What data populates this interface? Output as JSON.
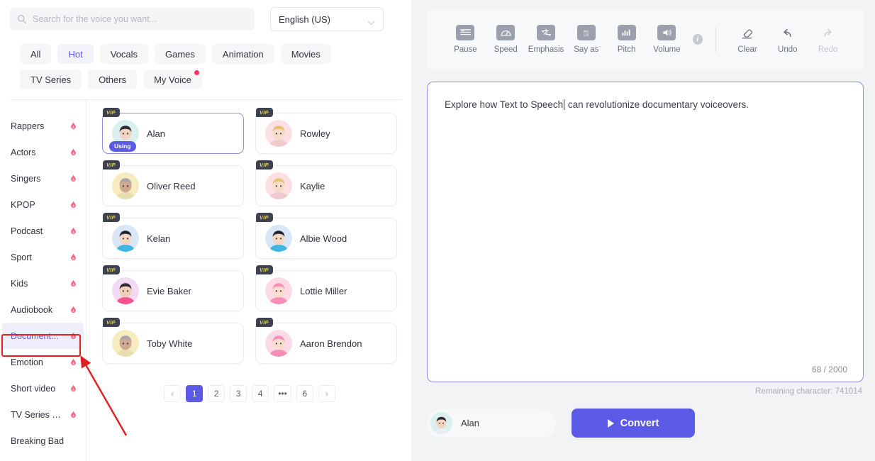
{
  "search": {
    "placeholder": "Search for the voice you want...",
    "value": "",
    "icon": "search-icon"
  },
  "language": {
    "selected": "English (US)",
    "icon": "chevron-down-icon"
  },
  "category_tabs": [
    {
      "label": "All",
      "active": false,
      "badge": false
    },
    {
      "label": "Hot",
      "active": true,
      "badge": false
    },
    {
      "label": "Vocals",
      "active": false,
      "badge": false
    },
    {
      "label": "Games",
      "active": false,
      "badge": false
    },
    {
      "label": "Animation",
      "active": false,
      "badge": false
    },
    {
      "label": "Movies",
      "active": false,
      "badge": false
    },
    {
      "label": "TV Series",
      "active": false,
      "badge": false
    },
    {
      "label": "Others",
      "active": false,
      "badge": false
    },
    {
      "label": "My Voice",
      "active": false,
      "badge": true
    }
  ],
  "sidebar": {
    "items": [
      {
        "label": "Rappers",
        "flame": true,
        "selected": false
      },
      {
        "label": "Actors",
        "flame": true,
        "selected": false
      },
      {
        "label": "Singers",
        "flame": true,
        "selected": false
      },
      {
        "label": "KPOP",
        "flame": true,
        "selected": false
      },
      {
        "label": "Podcast",
        "flame": true,
        "selected": false
      },
      {
        "label": "Sport",
        "flame": true,
        "selected": false
      },
      {
        "label": "Kids",
        "flame": true,
        "selected": false
      },
      {
        "label": "Audiobook",
        "flame": true,
        "selected": false
      },
      {
        "label": "Document...",
        "flame": true,
        "selected": true
      },
      {
        "label": "Emotion",
        "flame": true,
        "selected": false
      },
      {
        "label": "Short video",
        "flame": true,
        "selected": false
      },
      {
        "label": "TV Series & ...",
        "flame": true,
        "selected": false
      },
      {
        "label": "Breaking Bad",
        "flame": false,
        "selected": false
      }
    ]
  },
  "voices": [
    {
      "name": "Alan",
      "vip": "VIP",
      "using": "Using",
      "selected": true,
      "avatar_bg": "#d9f0ee",
      "hair": "#2a2a33",
      "skin": "#f2d3bd",
      "accent": "#e8eef6"
    },
    {
      "name": "Rowley",
      "vip": "VIP",
      "using": null,
      "selected": false,
      "avatar_bg": "#fbdfe2",
      "hair": "#e8c173",
      "skin": "#f6ddc9",
      "accent": "#f0c9cd"
    },
    {
      "name": "Oliver Reed",
      "vip": "VIP",
      "using": null,
      "selected": false,
      "avatar_bg": "#f7ecbf",
      "hair": "#a8a4ad",
      "skin": "#cfa98f",
      "accent": "#e9dcae"
    },
    {
      "name": "Kaylie",
      "vip": "VIP",
      "using": null,
      "selected": false,
      "avatar_bg": "#fbdfe2",
      "hair": "#e8c173",
      "skin": "#f6ddc9",
      "accent": "#f0c9cd"
    },
    {
      "name": "Kelan",
      "vip": "VIP",
      "using": null,
      "selected": false,
      "avatar_bg": "#d8e6f8",
      "hair": "#23252e",
      "skin": "#f3d7c2",
      "accent": "#3fb6e0"
    },
    {
      "name": "Albie Wood",
      "vip": "VIP",
      "using": null,
      "selected": false,
      "avatar_bg": "#d8e6f8",
      "hair": "#23252e",
      "skin": "#f3d7c2",
      "accent": "#3fb6e0"
    },
    {
      "name": "Evie Baker",
      "vip": "VIP",
      "using": null,
      "selected": false,
      "avatar_bg": "#f3d9f2",
      "hair": "#2d2d35",
      "skin": "#f0cdb4",
      "accent": "#f7518e"
    },
    {
      "name": "Lottie Miller",
      "vip": "VIP",
      "using": null,
      "selected": false,
      "avatar_bg": "#fadae6",
      "hair": "#f98fb8",
      "skin": "#f8ddcb",
      "accent": "#f98fb8"
    },
    {
      "name": "Toby White",
      "vip": "VIP",
      "using": null,
      "selected": false,
      "avatar_bg": "#f7ecbf",
      "hair": "#a8a4ad",
      "skin": "#cfa98f",
      "accent": "#e9dcae"
    },
    {
      "name": "Aaron Brendon",
      "vip": "VIP",
      "using": null,
      "selected": false,
      "avatar_bg": "#fadae6",
      "hair": "#f98fb8",
      "skin": "#f8ddcb",
      "accent": "#f98fb8"
    }
  ],
  "pagination": {
    "prev": "‹",
    "next": "›",
    "pages": [
      "1",
      "2",
      "3",
      "4",
      "•••",
      "6"
    ],
    "current": "1"
  },
  "toolbar": {
    "tools": [
      {
        "label": "Pause",
        "icon": "pause-lines-icon",
        "disabled": false
      },
      {
        "label": "Speed",
        "icon": "speedometer-icon",
        "disabled": false
      },
      {
        "label": "Emphasis",
        "icon": "emphasis-arrows-icon",
        "disabled": false
      },
      {
        "label": "Say as",
        "icon": "abc-123-icon",
        "disabled": false
      },
      {
        "label": "Pitch",
        "icon": "pitch-bars-icon",
        "disabled": false
      },
      {
        "label": "Volume",
        "icon": "volume-speaker-icon",
        "disabled": false
      }
    ],
    "info_icon": "info-icon",
    "info_glyph": "i",
    "actions": [
      {
        "label": "Clear",
        "icon": "eraser-icon",
        "disabled": false
      },
      {
        "label": "Undo",
        "icon": "undo-arrow-icon",
        "disabled": false
      },
      {
        "label": "Redo",
        "icon": "redo-arrow-icon",
        "disabled": true
      }
    ]
  },
  "editor": {
    "text_before_caret": "Explore how Text to Speech",
    "text_after_caret": " can revolutionize documentary voiceovers.",
    "char_count": "68 / 2000",
    "remaining": "Remaining character: 741014"
  },
  "footer": {
    "voice_chip_name": "Alan",
    "convert_label": "Convert",
    "play_icon": "play-icon"
  },
  "colors": {
    "accent": "#5a5ae6",
    "accent_light": "#eeeefb",
    "badge_pink": "#f7386d",
    "annotation_red": "#e02020",
    "vip_gold": "#e8c86a",
    "vip_dark": "#3d4250"
  }
}
